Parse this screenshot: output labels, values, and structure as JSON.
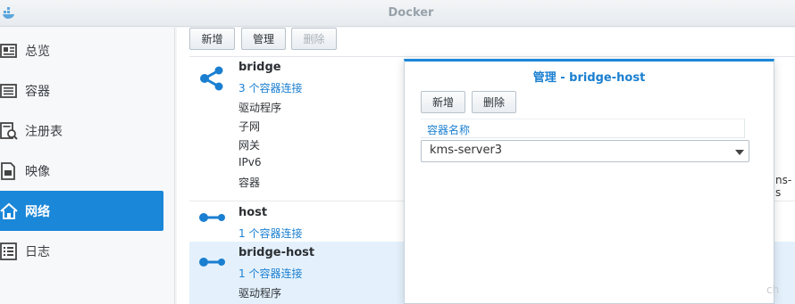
{
  "window": {
    "title": "Docker",
    "logo_icon": "docker-whale-icon"
  },
  "sidebar": {
    "items": [
      {
        "label": "总览",
        "icon": "overview-icon",
        "active": false
      },
      {
        "label": "容器",
        "icon": "container-icon",
        "active": false
      },
      {
        "label": "注册表",
        "icon": "registry-icon",
        "active": false
      },
      {
        "label": "映像",
        "icon": "image-icon",
        "active": false
      },
      {
        "label": "网络",
        "icon": "network-home-icon",
        "active": true
      },
      {
        "label": "日志",
        "icon": "log-icon",
        "active": false
      }
    ]
  },
  "toolbar": {
    "add_label": "新增",
    "manage_label": "管理",
    "delete_label": "删除"
  },
  "networks": [
    {
      "name": "bridge",
      "icon": "share-network-icon",
      "connections": "3 个容器连接",
      "properties": [
        "驱动程序",
        "子网",
        "网关",
        "IPv6",
        "容器"
      ],
      "selected": false
    },
    {
      "name": "host",
      "icon": "link-network-icon",
      "connections": "1 个容器连接",
      "properties": [],
      "selected": false
    },
    {
      "name": "bridge-host",
      "icon": "link-network-icon",
      "connections": "1 个容器连接",
      "properties": [
        "驱动程序"
      ],
      "selected": true
    }
  ],
  "clipped_value": "ns-s",
  "watermark": "ch",
  "modal": {
    "title": "管理 - bridge-host",
    "add_label": "新增",
    "delete_label": "删除",
    "column_header": "容器名称",
    "selected_container": "kms-server3"
  },
  "colors": {
    "accent": "#1a87d8",
    "link": "#1a7fd1",
    "selected_row": "#e4f1fc"
  }
}
